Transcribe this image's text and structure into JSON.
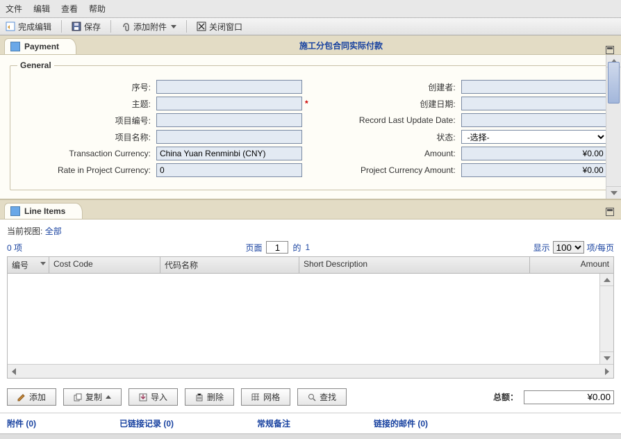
{
  "menubar": {
    "file": "文件",
    "edit": "编辑",
    "view": "查看",
    "help": "帮助"
  },
  "toolbar": {
    "finish_edit": "完成编辑",
    "save": "保存",
    "add_attachment": "添加附件",
    "close_window": "关闭窗口"
  },
  "page": {
    "tab_title": "Payment",
    "title": "施工分包合同实际付款"
  },
  "general": {
    "legend": "General",
    "labels": {
      "seq": "序号:",
      "subject": "主题:",
      "project_no": "项目编号:",
      "project_name": "项目名称:",
      "txn_currency": "Transaction Currency:",
      "rate": "Rate in Project Currency:",
      "creator": "创建者:",
      "create_date": "创建日期:",
      "record_last_update": "Record Last Update Date:",
      "status": "状态:",
      "amount": "Amount:",
      "proj_amount": "Project Currency Amount:"
    },
    "values": {
      "seq": "",
      "subject": "",
      "project_no": "",
      "project_name": "",
      "txn_currency": "China Yuan Renminbi (CNY)",
      "rate": "0",
      "creator": "",
      "create_date": "",
      "record_last_update": "",
      "status": "-选择-",
      "amount": "¥0.00",
      "proj_amount": "¥0.00"
    }
  },
  "line_items": {
    "section_title": "Line Items",
    "current_view_label": "当前视图:",
    "current_view_value": "全部",
    "count": "0 项",
    "page_label": "页面",
    "page_value": "1",
    "page_of_label": "的",
    "page_total": "1",
    "show_label": "显示",
    "show_value": "100",
    "per_page": "项/每页",
    "columns": {
      "no": "编号",
      "cost_code": "Cost Code",
      "code_name": "代码名称",
      "short_desc": "Short Description",
      "amount": "Amount"
    }
  },
  "actions": {
    "add": "添加",
    "copy": "复制",
    "import": "导入",
    "remove": "删除",
    "grid": "网格",
    "find": "查找"
  },
  "total": {
    "label": "总额：",
    "value": "¥0.00"
  },
  "footer": {
    "attachments": "附件 (0)",
    "linked_records": "已链接记录 (0)",
    "general_notes": "常规备注",
    "linked_mails": "链接的邮件 (0)"
  }
}
